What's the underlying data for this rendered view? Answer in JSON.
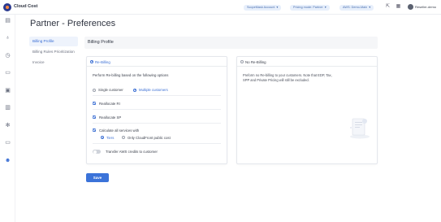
{
  "app": {
    "title": "Cloud Cost"
  },
  "header": {
    "selectors": [
      {
        "label": "ScopeMask Account"
      },
      {
        "label": "Pricing mode: Partner"
      },
      {
        "label": "AWS: Demo-Main"
      }
    ],
    "user": {
      "name": "Reseller-demo"
    }
  },
  "sidebar": {
    "icons": [
      "dashboard-icon",
      "lightbulb-icon",
      "clock-icon",
      "chat-icon",
      "database-icon",
      "bar-chart-icon",
      "settings-icon",
      "monitor-icon",
      "users-icon"
    ],
    "active_index": 8
  },
  "page": {
    "title": "Partner - Preferences"
  },
  "subnav": {
    "items": [
      {
        "label": "Billing Profile",
        "active": true
      },
      {
        "label": "Billing Rules Prioritization",
        "active": false
      },
      {
        "label": "Invoice",
        "active": false
      }
    ]
  },
  "section": {
    "title": "Billing Profile"
  },
  "rebilling": {
    "title": "Re-Billing",
    "selected": true,
    "intro": "Perform Re-billing based on the following options",
    "customer_options": [
      {
        "label": "Single customer",
        "selected": false
      },
      {
        "label": "Multiple customers",
        "selected": true
      }
    ],
    "checks": [
      {
        "label": "Reallocate RI",
        "checked": true
      },
      {
        "label": "Reallocate SP",
        "checked": true
      },
      {
        "label": "Calculate all services with",
        "checked": true
      }
    ],
    "cost_options": [
      {
        "label": "Tiers",
        "selected": true
      },
      {
        "label": "Only CloudFront public cost",
        "selected": false
      }
    ],
    "transfer_toggle": {
      "label": "Transfer AWS credits to customer",
      "on": false
    }
  },
  "no_rebilling": {
    "title": "No Re-Billing",
    "selected": false,
    "description": "Preform no Re-billing to your customers. Note that EDP, Tax, SPP and Private Pricing will still be excluded."
  },
  "actions": {
    "save_label": "Save"
  },
  "colors": {
    "accent": "#3b6fd4",
    "primary_button": "#3b73d9"
  }
}
